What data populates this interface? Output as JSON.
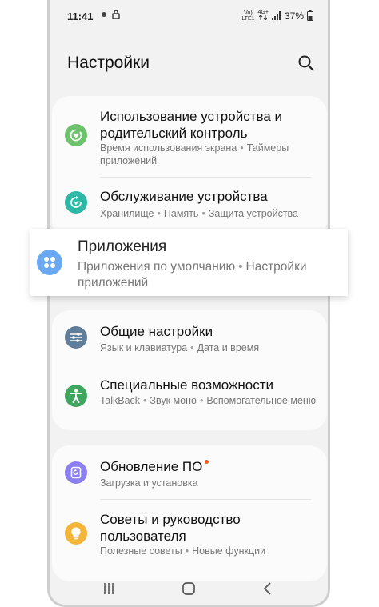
{
  "status": {
    "time": "11:41",
    "volte_top": "Vo)",
    "volte_bottom": "LTE1",
    "net_top": "4G+",
    "net_bottom": "",
    "battery": "37%"
  },
  "header": {
    "title": "Настройки"
  },
  "items": [
    {
      "title": "Использование устройства и родительский контроль",
      "sub": [
        "Время использования экрана",
        "Таймеры приложений"
      ],
      "color": "#6cc36b"
    },
    {
      "title": "Обслуживание устройства",
      "sub": [
        "Хранилище",
        "Память",
        "Защита устройства"
      ],
      "color": "#2db8a6"
    },
    {
      "title": "Общие настройки",
      "sub": [
        "Язык и клавиатура",
        "Дата и время"
      ],
      "color": "#607e9a"
    },
    {
      "title": "Специальные возможности",
      "sub": [
        "TalkBack",
        "Звук моно",
        "Вспомогательное меню"
      ],
      "color": "#3fa65f"
    },
    {
      "title": "Обновление ПО",
      "sub": [
        "Загрузка и установка"
      ],
      "color": "#8c7ff0"
    },
    {
      "title": "Советы и руководство пользователя",
      "sub": [
        "Полезные советы",
        "Новые функции"
      ],
      "color": "#f4b63a"
    }
  ],
  "popup": {
    "title": "Приложения",
    "sub": [
      "Приложения по умолчанию",
      "Настройки приложений"
    ],
    "color": "#6aa8f2"
  }
}
